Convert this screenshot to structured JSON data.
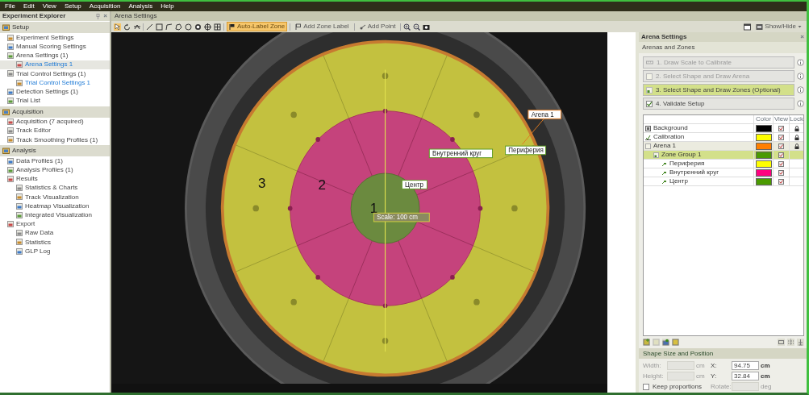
{
  "menu": [
    "File",
    "Edit",
    "View",
    "Setup",
    "Acquisition",
    "Analysis",
    "Help"
  ],
  "explorer": {
    "title": "Experiment Explorer",
    "close": "×",
    "sections": [
      {
        "title": "Setup",
        "items": [
          {
            "label": "Experiment Settings",
            "selected": false,
            "kind": "item"
          },
          {
            "label": "Manual Scoring Settings",
            "selected": false,
            "kind": "item"
          },
          {
            "label": "Arena Settings (1)",
            "selected": false,
            "kind": "item",
            "children": [
              {
                "label": "Arena Settings 1",
                "selected": true,
                "kind": "instance"
              }
            ]
          },
          {
            "label": "Trial Control Settings (1)",
            "selected": false,
            "kind": "item",
            "children": [
              {
                "label": "Trial Control Settings 1",
                "selected": false,
                "kind": "instance"
              }
            ]
          },
          {
            "label": "Detection Settings (1)",
            "selected": false,
            "kind": "item"
          },
          {
            "label": "Trial List",
            "selected": false,
            "kind": "item"
          }
        ]
      },
      {
        "title": "Acquisition",
        "items": [
          {
            "label": "Acquisition (7 acquired)",
            "selected": false,
            "kind": "item"
          },
          {
            "label": "Track Editor",
            "selected": false,
            "kind": "item"
          },
          {
            "label": "Track Smoothing Profiles (1)",
            "selected": false,
            "kind": "item"
          }
        ]
      },
      {
        "title": "Analysis",
        "items": [
          {
            "label": "Data Profiles (1)",
            "selected": false,
            "kind": "item"
          },
          {
            "label": "Analysis Profiles (1)",
            "selected": false,
            "kind": "item"
          },
          {
            "label": "Results",
            "selected": false,
            "kind": "item",
            "children": [
              {
                "label": "Statistics & Charts",
                "selected": false,
                "kind": "item"
              },
              {
                "label": "Track Visualization",
                "selected": false,
                "kind": "item"
              },
              {
                "label": "Heatmap Visualization",
                "selected": false,
                "kind": "item"
              },
              {
                "label": "Integrated Visualization",
                "selected": false,
                "kind": "item"
              }
            ]
          },
          {
            "label": "Export",
            "selected": false,
            "kind": "item",
            "children": [
              {
                "label": "Raw Data",
                "selected": false,
                "kind": "item"
              },
              {
                "label": "Statistics",
                "selected": false,
                "kind": "item"
              },
              {
                "label": "GLP Log",
                "selected": false,
                "kind": "item"
              }
            ]
          }
        ]
      }
    ]
  },
  "document": {
    "title": "Arena Settings"
  },
  "toolbar": {
    "buttons": [
      {
        "label": "Auto-Label Zone",
        "selected": true
      },
      {
        "label": "Add Zone Label",
        "selected": false
      },
      {
        "label": "Add Point",
        "selected": false
      }
    ],
    "show_hide": "Show/Hide"
  },
  "canvas": {
    "zone_numbers": [
      "3",
      "2",
      "1"
    ],
    "labels": [
      {
        "text": "Внутренний круг",
        "kind": "zone"
      },
      {
        "text": "Периферия",
        "kind": "zone"
      },
      {
        "text": "Центр",
        "kind": "zone"
      },
      {
        "text": "Arena 1",
        "kind": "arena"
      },
      {
        "text": "Scale: 100 cm",
        "kind": "scale"
      }
    ]
  },
  "panel": {
    "title": "Arena Settings",
    "close": "×",
    "subtitle": "Arenas and Zones",
    "steps": [
      {
        "label": "1. Draw Scale to Calibrate",
        "kind": "ruler",
        "disabled": true,
        "selected": false
      },
      {
        "label": "2. Select Shape and Draw Arena",
        "kind": "square",
        "disabled": true,
        "selected": false
      },
      {
        "label": "3. Select Shape and Draw Zones (Optional)",
        "kind": "square",
        "disabled": false,
        "selected": true
      },
      {
        "label": "4. Validate Setup",
        "kind": "checkbox",
        "disabled": false,
        "selected": false,
        "checked": true
      }
    ],
    "columns": [
      "Color",
      "View",
      "Lock"
    ],
    "rows": [
      {
        "name": "Background",
        "kind": "background",
        "color": "#000000",
        "view": true,
        "lock": true,
        "selected": false
      },
      {
        "name": "Calibration",
        "kind": "calibration",
        "color": "#ffff00",
        "view": true,
        "lock": true,
        "selected": false
      },
      {
        "name": "Arena 1",
        "kind": "arena",
        "color": "#ff7f00",
        "view": true,
        "lock": true,
        "selected": false,
        "children": [
          {
            "name": "Zone Group 1",
            "kind": "group",
            "color": "#4a9a00",
            "view": true,
            "lock": false,
            "selected": true,
            "children": [
              {
                "name": "Периферия",
                "kind": "zone",
                "color": "#ffff00",
                "view": true,
                "lock": false,
                "selected": false
              },
              {
                "name": "Внутренний круг",
                "kind": "zone",
                "color": "#ff0080",
                "view": true,
                "lock": false,
                "selected": false
              },
              {
                "name": "Центр",
                "kind": "zone",
                "color": "#4a9a00",
                "view": true,
                "lock": false,
                "selected": false
              }
            ]
          }
        ]
      }
    ],
    "shape": {
      "title": "Shape Size and Position",
      "rows": [
        [
          {
            "kind": "field",
            "label": "Width:",
            "unit": "cm",
            "disabled": true
          },
          {
            "kind": "field",
            "label": "X:",
            "value": "94.75",
            "unit": "cm",
            "disabled": false
          }
        ],
        [
          {
            "kind": "field",
            "label": "Height:",
            "unit": "cm",
            "disabled": true
          },
          {
            "kind": "field",
            "label": "Y:",
            "value": "32.84",
            "unit": "cm",
            "disabled": false
          }
        ],
        [
          {
            "kind": "checkbox",
            "label": "Keep proportions",
            "checked": false
          },
          {
            "kind": "field",
            "label": "Rotate:",
            "unit": "deg",
            "disabled": true
          }
        ]
      ]
    }
  }
}
